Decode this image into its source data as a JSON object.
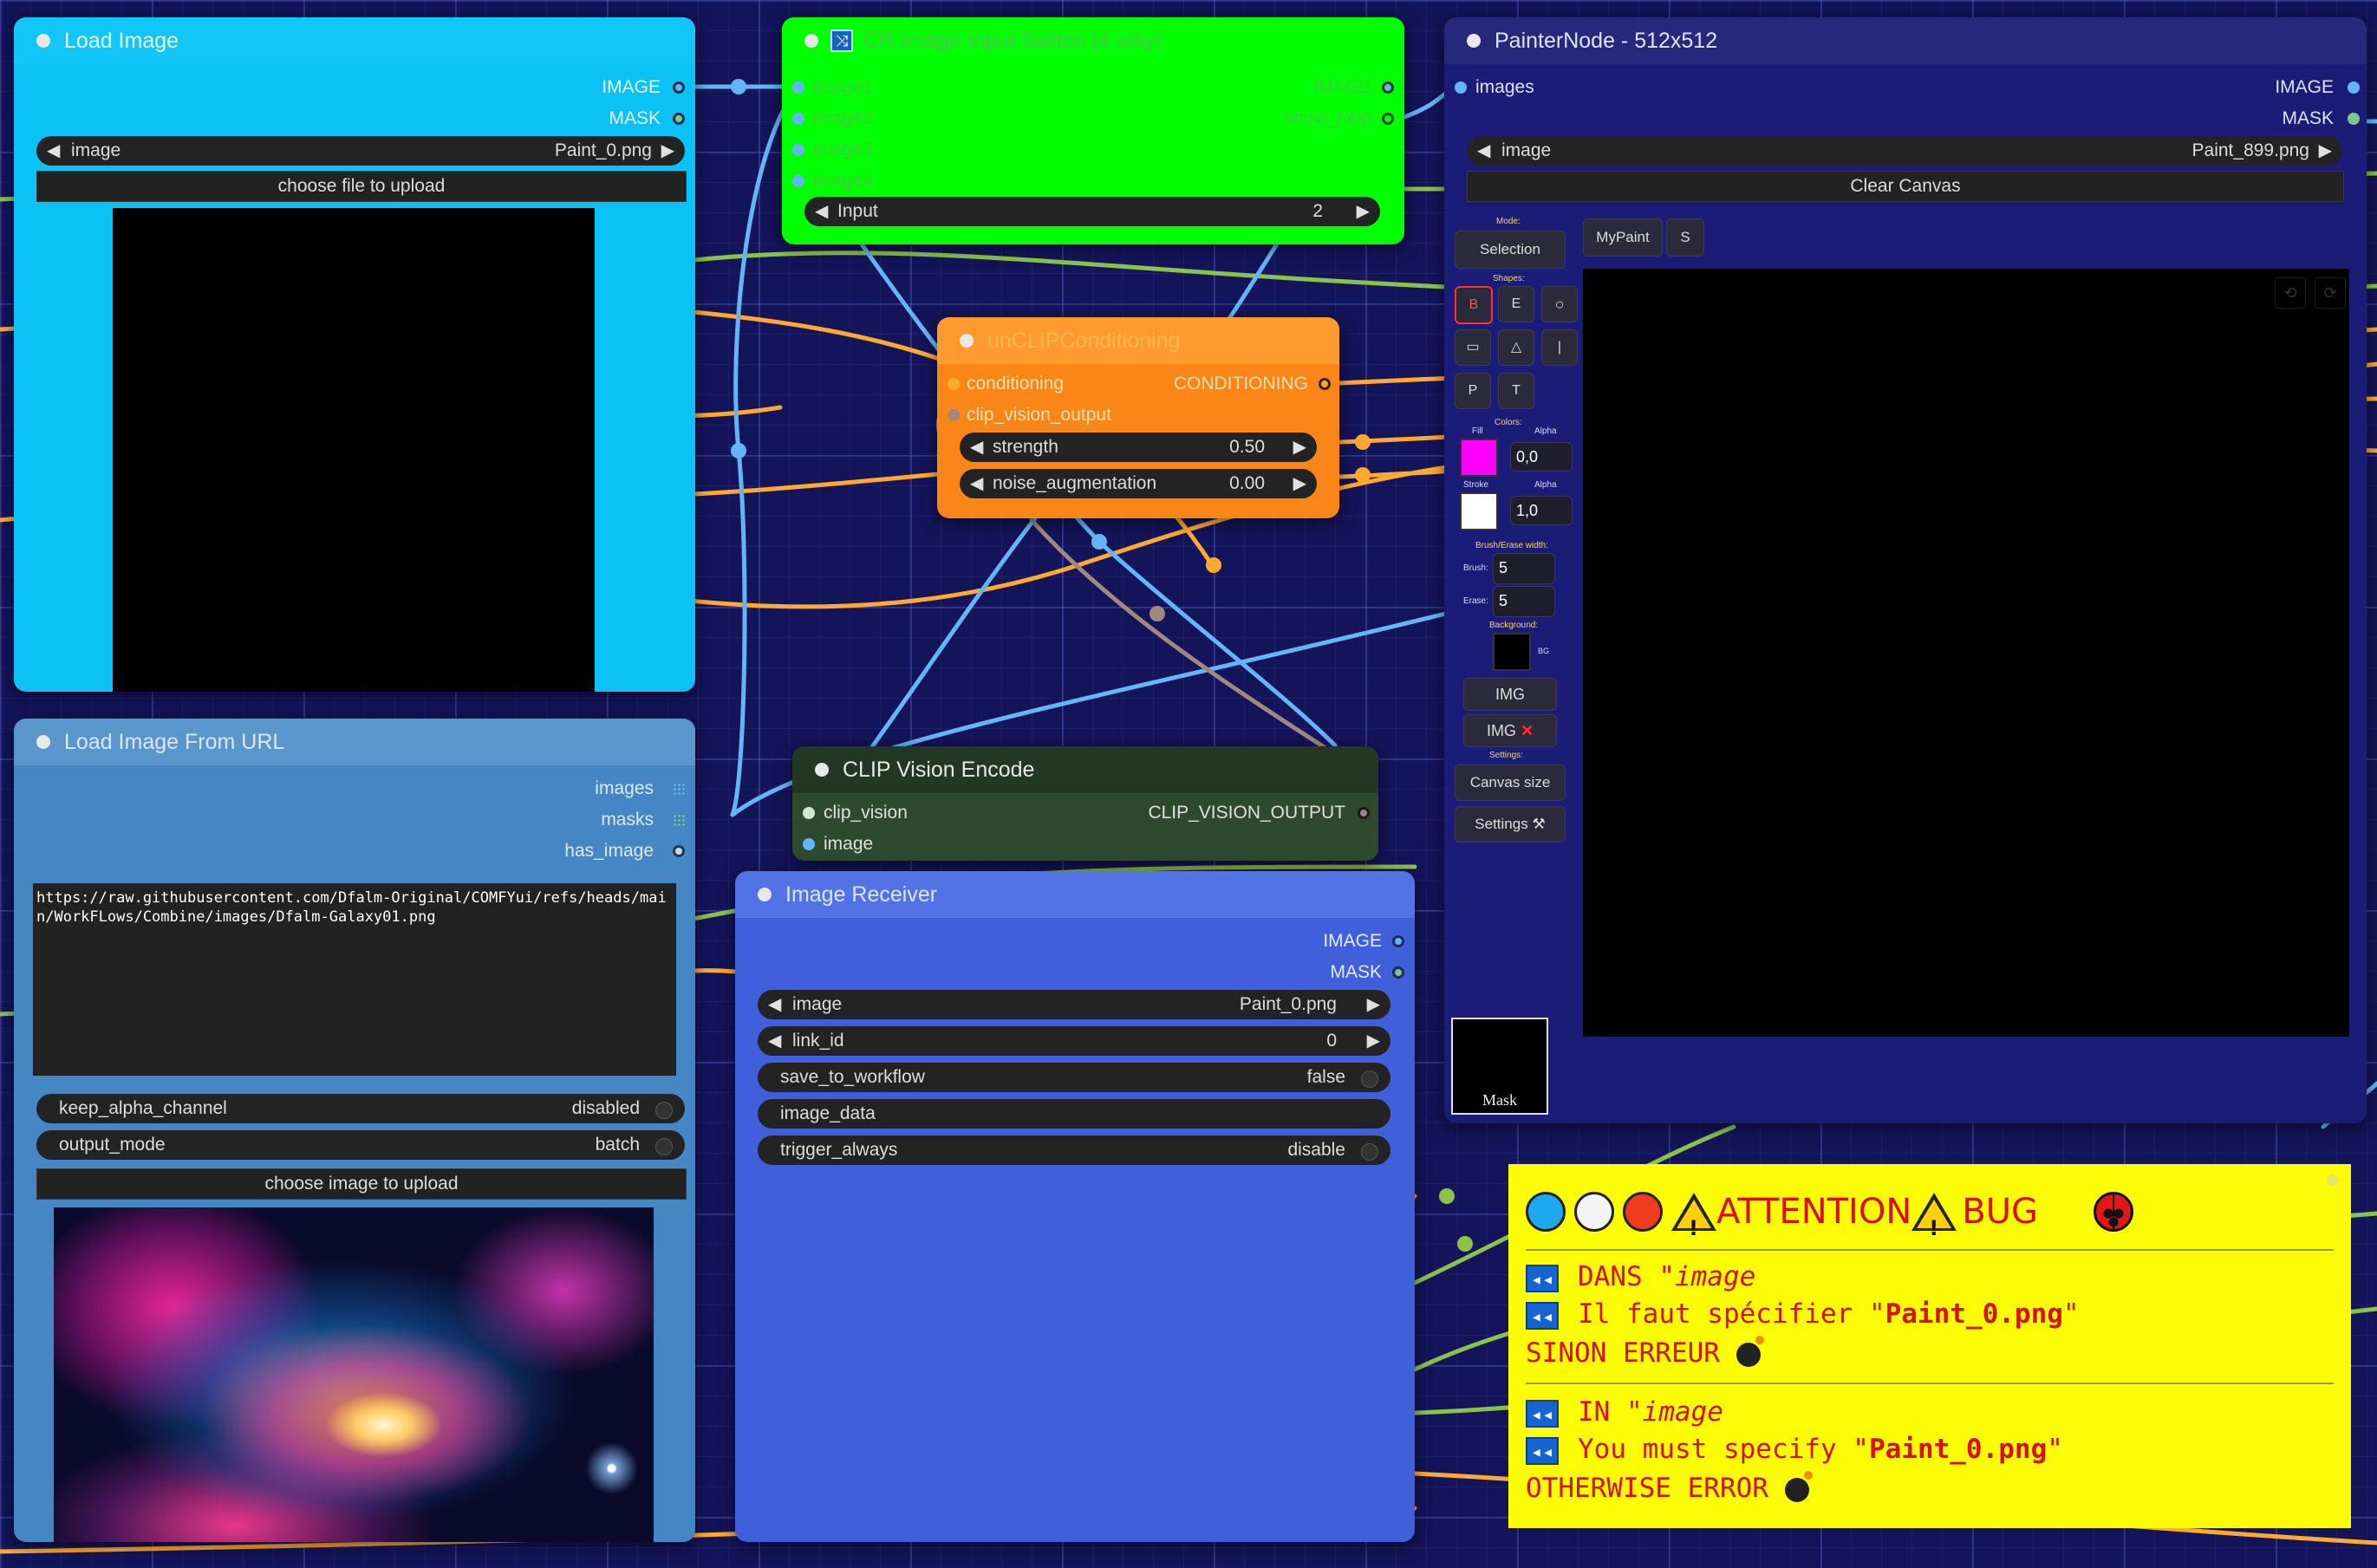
{
  "canvas_colors": {
    "background": "#14145a",
    "link_image": "#64b5f6",
    "link_conditioning": "#ffa931",
    "link_clip_vision": "#a1887f",
    "link_mask": "#81c784"
  },
  "load_image": {
    "title": "Load Image",
    "outputs": [
      "IMAGE",
      "MASK"
    ],
    "image_label": "image",
    "image_value": "Paint_0.png",
    "upload_label": "choose file to upload"
  },
  "switch": {
    "title": "CR Image Input Switch (4 way)",
    "icon": "shuffle-icon",
    "inputs": [
      "image1",
      "image2",
      "image3",
      "image4"
    ],
    "outputs": [
      "IMAGE",
      "show_help"
    ],
    "input_label": "Input",
    "input_value": "2"
  },
  "painter": {
    "title": "PainterNode - 512x512",
    "input": "images",
    "outputs": [
      "IMAGE",
      "MASK"
    ],
    "image_label": "image",
    "image_value": "Paint_899.png",
    "clear_label": "Clear Canvas",
    "mode_label": "Mode:",
    "mode_value": "Selection",
    "tabs": [
      "MyPaint",
      "S"
    ],
    "shapes_label": "Shapes:",
    "shape_buttons": [
      "B",
      "E",
      "○",
      "▭",
      "△",
      "|",
      "P",
      "T"
    ],
    "colors_label": "Colors:",
    "fill_label": "Fill",
    "alpha_label": "Alpha",
    "fill_color": "#ff00ff",
    "fill_alpha": "0,0",
    "stroke_label": "Stroke",
    "stroke_color": "#ffffff",
    "stroke_alpha": "1,0",
    "brush_erase_label": "Brush/Erase width:",
    "brush_label": "Brush:",
    "brush_value": "5",
    "erase_label": "Erase:",
    "erase_value": "5",
    "background_label": "Background:",
    "bg_label": "BG",
    "img_label": "IMG",
    "img_x_label": "IMG",
    "settings_label": "Settings:",
    "canvas_size_label": "Canvas size",
    "settings_button": "Settings",
    "mask_label": "Mask"
  },
  "unclip": {
    "title": "unCLIPConditioning",
    "inputs": [
      "conditioning",
      "clip_vision_output"
    ],
    "output": "CONDITIONING",
    "strength_label": "strength",
    "strength_value": "0.50",
    "noise_label": "noise_augmentation",
    "noise_value": "0.00"
  },
  "url_loader": {
    "title": "Load Image From URL",
    "outputs": [
      "images",
      "masks",
      "has_image"
    ],
    "url_text": "https://raw.githubusercontent.com/Dfalm-Original/COMFYui/refs/heads/main/WorkFLows/Combine/images/Dfalm-Galaxy01.png",
    "keep_alpha_label": "keep_alpha_channel",
    "keep_alpha_value": "disabled",
    "output_mode_label": "output_mode",
    "output_mode_value": "batch",
    "upload_label": "choose image to upload"
  },
  "clip_vision": {
    "title": "CLIP Vision Encode",
    "inputs": [
      "clip_vision",
      "image"
    ],
    "output": "CLIP_VISION_OUTPUT"
  },
  "receiver": {
    "title": "Image Receiver",
    "outputs": [
      "IMAGE",
      "MASK"
    ],
    "image_label": "image",
    "image_value": "Paint_0.png",
    "link_id_label": "link_id",
    "link_id_value": "0",
    "save_label": "save_to_workflow",
    "save_value": "false",
    "image_data_label": "image_data",
    "trigger_label": "trigger_always",
    "trigger_value": "disable"
  },
  "note": {
    "header": "ATTENTION",
    "bug": "BUG",
    "fr_line1_prefix": "DANS \"",
    "fr_line1_word": "image",
    "fr_line2_prefix": "Il faut spécifier \"",
    "fr_line2_file": "Paint_0.png",
    "fr_line2_suffix": "\"",
    "fr_line3": "SINON ERREUR",
    "en_line1_prefix": "IN \"",
    "en_line1_word": "image",
    "en_line2_prefix": "You must specify \"",
    "en_line2_file": "Paint_0.png",
    "en_line2_suffix": "\"",
    "en_line3": "OTHERWISE ERROR",
    "rewind_glyph": "◂◂"
  }
}
